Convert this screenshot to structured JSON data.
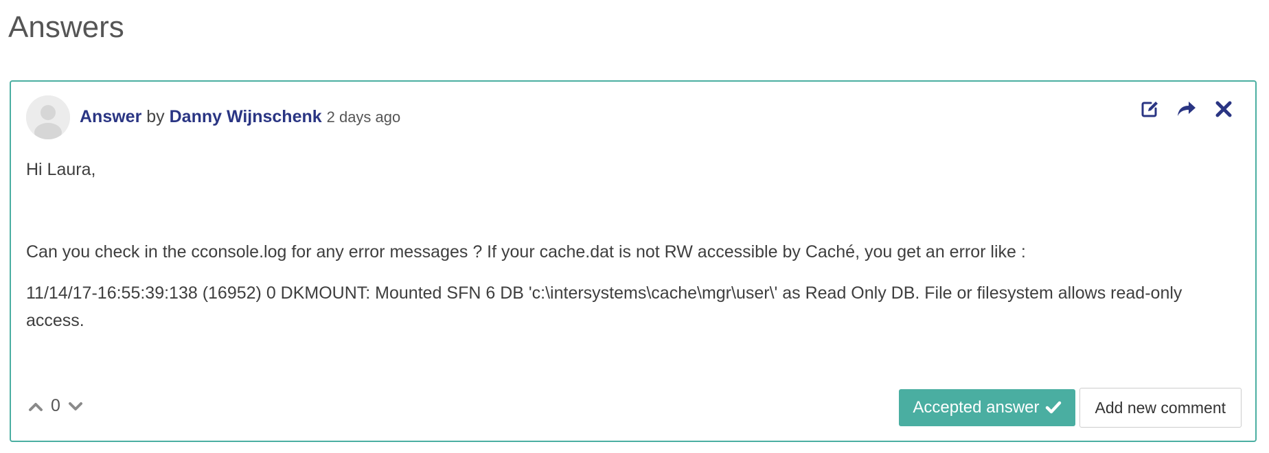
{
  "page": {
    "heading": "Answers"
  },
  "answer": {
    "label": "Answer",
    "by_text": " by ",
    "author": "Danny Wijnschenk",
    "time_ago": "2 days ago",
    "icons": {
      "edit": "edit-icon",
      "share": "share-icon",
      "delete": "close-icon",
      "color": "#2a3583"
    },
    "body": {
      "greeting": "Hi Laura,",
      "question": "Can you check in the cconsole.log for any error messages ? If your cache.dat is not RW accessible by Caché, you get an error like :",
      "log_line": "11/14/17-16:55:39:138 (16952) 0 DKMOUNT: Mounted SFN 6 DB 'c:\\intersystems\\cache\\mgr\\user\\' as Read Only DB. File or filesystem allows read-only access."
    },
    "votes": {
      "count": "0",
      "up_icon": "chevron-up-icon",
      "down_icon": "chevron-down-icon"
    },
    "buttons": {
      "accepted": "Accepted answer",
      "accepted_icon": "checkmark-icon",
      "add_comment": "Add new comment"
    }
  },
  "colors": {
    "accent": "#4aaea1",
    "link": "#2a3583"
  }
}
